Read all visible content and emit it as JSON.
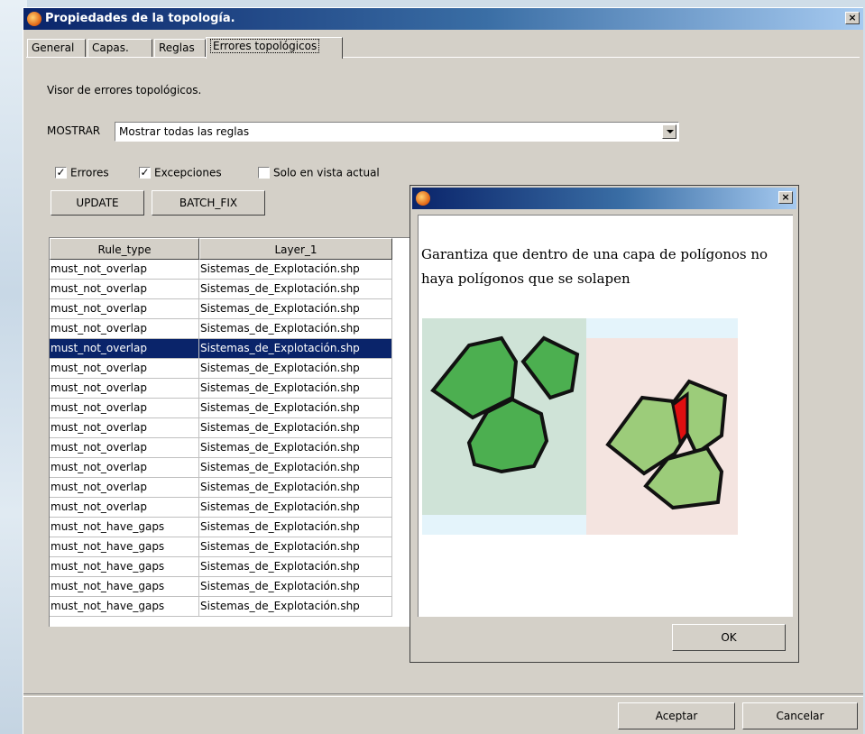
{
  "window": {
    "title": "Propiedades de la topología.",
    "close_label": "×"
  },
  "tabs": [
    {
      "label": "General"
    },
    {
      "label": "Capas."
    },
    {
      "label": "Reglas"
    },
    {
      "label": "Errores topológicos",
      "active": true
    }
  ],
  "viewer": {
    "heading": "Visor de errores topológicos.",
    "show_label": "MOSTRAR",
    "show_value": "Mostrar todas las reglas",
    "checkboxes": [
      {
        "label": "Errores",
        "checked": true
      },
      {
        "label": "Excepciones",
        "checked": true
      },
      {
        "label": "Solo en vista actual",
        "checked": false
      }
    ],
    "update_label": "UPDATE",
    "batch_fix_label": "BATCH_FIX"
  },
  "table": {
    "columns": [
      "Rule_type",
      "Layer_1"
    ],
    "selected_row": 4,
    "rows": [
      [
        "must_not_overlap",
        "Sistemas_de_Explotación.shp"
      ],
      [
        "must_not_overlap",
        "Sistemas_de_Explotación.shp"
      ],
      [
        "must_not_overlap",
        "Sistemas_de_Explotación.shp"
      ],
      [
        "must_not_overlap",
        "Sistemas_de_Explotación.shp"
      ],
      [
        "must_not_overlap",
        "Sistemas_de_Explotación.shp"
      ],
      [
        "must_not_overlap",
        "Sistemas_de_Explotación.shp"
      ],
      [
        "must_not_overlap",
        "Sistemas_de_Explotación.shp"
      ],
      [
        "must_not_overlap",
        "Sistemas_de_Explotación.shp"
      ],
      [
        "must_not_overlap",
        "Sistemas_de_Explotación.shp"
      ],
      [
        "must_not_overlap",
        "Sistemas_de_Explotación.shp"
      ],
      [
        "must_not_overlap",
        "Sistemas_de_Explotación.shp"
      ],
      [
        "must_not_overlap",
        "Sistemas_de_Explotación.shp"
      ],
      [
        "must_not_overlap",
        "Sistemas_de_Explotación.shp"
      ],
      [
        "must_not_have_gaps",
        "Sistemas_de_Explotación.shp"
      ],
      [
        "must_not_have_gaps",
        "Sistemas_de_Explotación.shp"
      ],
      [
        "must_not_have_gaps",
        "Sistemas_de_Explotación.shp"
      ],
      [
        "must_not_have_gaps",
        "Sistemas_de_Explotación.shp"
      ],
      [
        "must_not_have_gaps",
        "Sistemas_de_Explotación.shp"
      ]
    ]
  },
  "popup": {
    "close_label": "×",
    "description": "Garantiza que dentro de una capa de polígonos no haya polígonos que se solapen",
    "ok_label": "OK"
  },
  "footer": {
    "accept_label": "Aceptar",
    "cancel_label": "Cancelar"
  },
  "colors": {
    "title_start": "#0a246a",
    "title_end": "#a6caf0",
    "selection": "#0a246a",
    "polygon_dark": "#4caf50",
    "polygon_light": "#9ccc7a",
    "overlap": "#e01010"
  }
}
